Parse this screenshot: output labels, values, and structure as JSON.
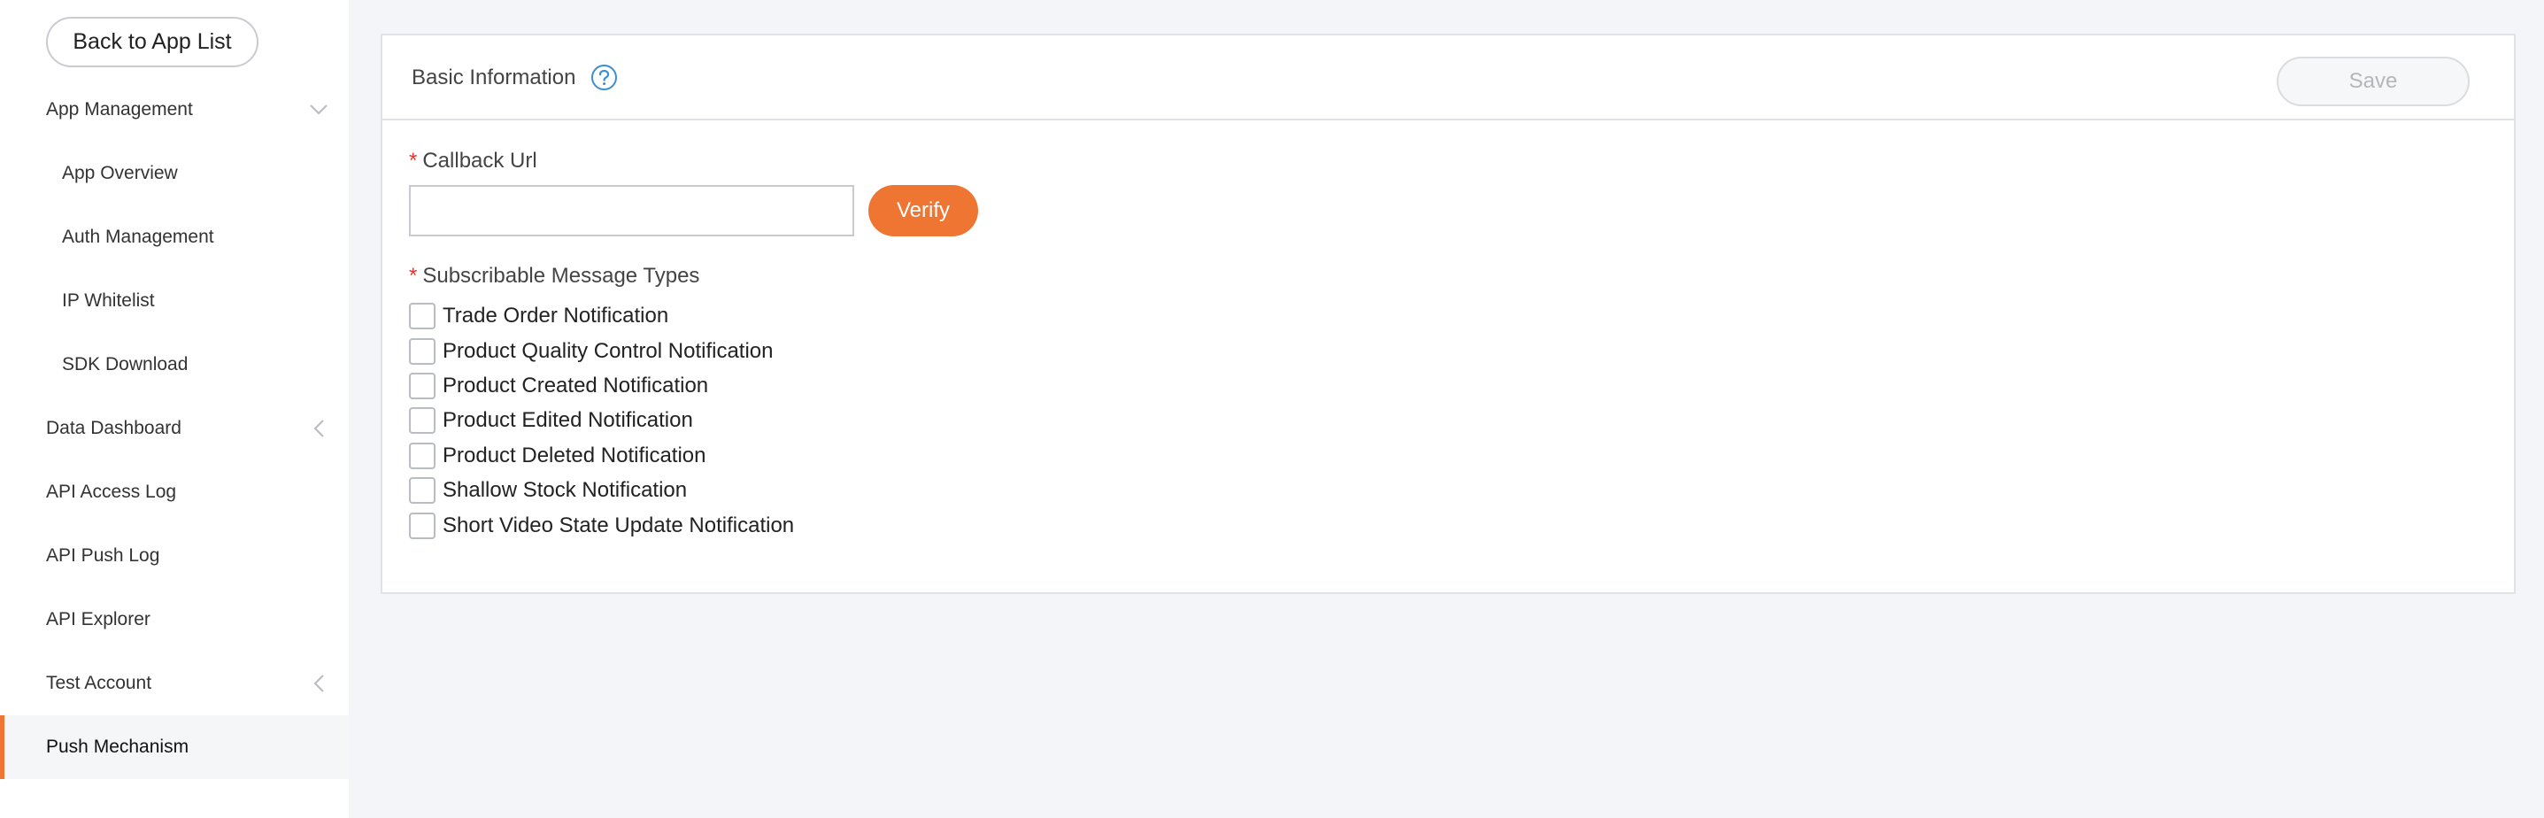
{
  "sidebar": {
    "back_label": "Back to App List",
    "items": [
      {
        "label": "App Management",
        "chevron": "down"
      },
      {
        "label": "App Overview"
      },
      {
        "label": "Auth Management"
      },
      {
        "label": "IP Whitelist"
      },
      {
        "label": "SDK Download"
      },
      {
        "label": "Data Dashboard",
        "chevron": "left"
      },
      {
        "label": "API Access Log"
      },
      {
        "label": "API Push Log"
      },
      {
        "label": "API Explorer"
      },
      {
        "label": "Test Account",
        "chevron": "left"
      },
      {
        "label": "Push Mechanism",
        "active": true
      }
    ]
  },
  "panel": {
    "title": "Basic Information",
    "save_label": "Save",
    "callback": {
      "required_mark": "*",
      "label": "Callback Url",
      "value": "",
      "placeholder": "",
      "verify_label": "Verify"
    },
    "message_types": {
      "required_mark": "*",
      "label": "Subscribable Message Types",
      "options": [
        {
          "label": "Trade Order Notification",
          "checked": false
        },
        {
          "label": "Product Quality Control Notification",
          "checked": false
        },
        {
          "label": "Product Created Notification",
          "checked": false
        },
        {
          "label": "Product Edited Notification",
          "checked": false
        },
        {
          "label": "Product Deleted Notification",
          "checked": false
        },
        {
          "label": "Shallow Stock Notification",
          "checked": false
        },
        {
          "label": "Short Video State Update Notification",
          "checked": false
        }
      ]
    }
  },
  "colors": {
    "accent": "#ef7632",
    "required": "#e5352b",
    "help_icon": "#3a8fd6",
    "background": "#f3f5f8"
  },
  "icons": {
    "help": "question-circle-icon",
    "chevron_down": "chevron-down-icon",
    "chevron_left": "chevron-left-icon"
  }
}
